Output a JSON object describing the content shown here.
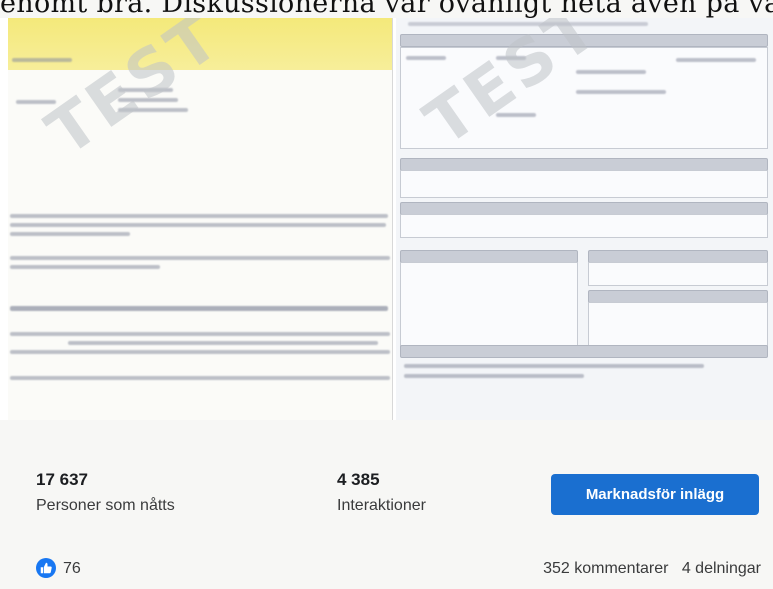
{
  "caption_fragment": "enomt bra. Diskussionerna var ovanligt heta även på vårt F",
  "image": {
    "watermark_text": "TEST"
  },
  "stats": {
    "reach_value": "17 637",
    "reach_label": "Personer som nåtts",
    "interactions_value": "4 385",
    "interactions_label": "Interaktioner",
    "promote_label": "Marknadsför inlägg"
  },
  "reactions": {
    "like_count": "76",
    "comments": "352 kommentarer",
    "shares": "4 delningar"
  },
  "colors": {
    "accent": "#1a6fd0",
    "like": "#1877f2"
  }
}
